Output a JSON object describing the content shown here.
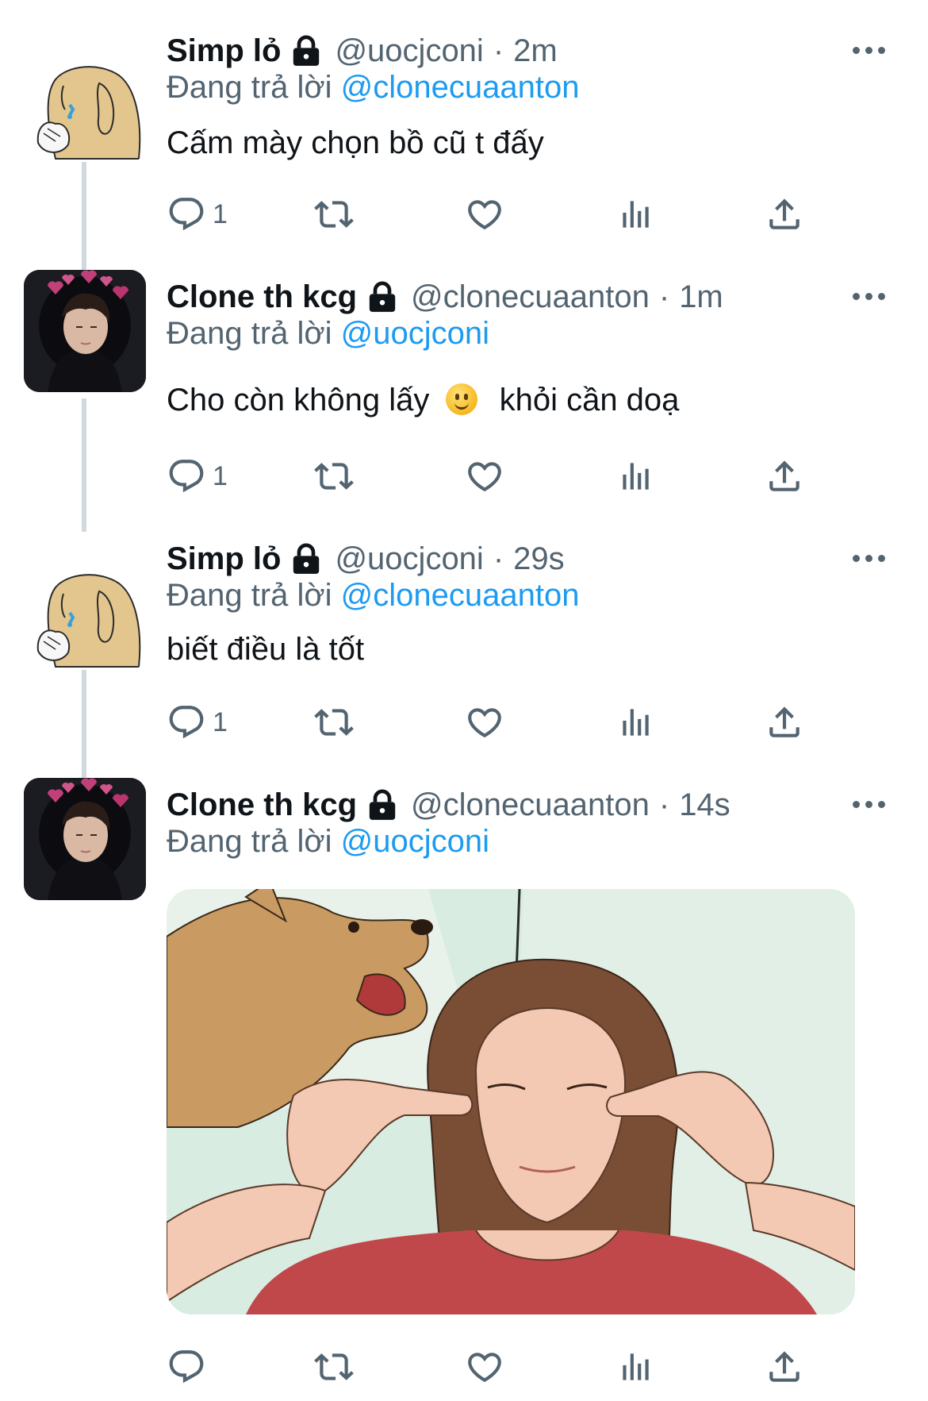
{
  "replying_label": "Đang trả lời",
  "tweets": [
    {
      "name": "Simp lỏ",
      "handle": "@uocjconi",
      "separator": "·",
      "time": "2m",
      "reply_to": "@clonecuaanton",
      "text": "Cấm mày chọn bồ cũ t đấy",
      "reply_count": "1",
      "avatar": "crying-dog-avatar"
    },
    {
      "name": "Clone th kcg",
      "handle": "@clonecuaanton",
      "separator": "·",
      "time": "1m",
      "reply_to": "@uocjconi",
      "text_before_emoji": "Cho còn không lấy",
      "emoji": "slightly-smiling-face",
      "text_after_emoji": "khỏi cần doạ",
      "reply_count": "1",
      "avatar": "person-with-hearts-avatar"
    },
    {
      "name": "Simp lỏ",
      "handle": "@uocjconi",
      "separator": "·",
      "time": "29s",
      "reply_to": "@clonecuaanton",
      "text": "biết điều là tốt",
      "reply_count": "1",
      "avatar": "crying-dog-avatar"
    },
    {
      "name": "Clone th kcg",
      "handle": "@clonecuaanton",
      "separator": "·",
      "time": "14s",
      "reply_to": "@uocjconi",
      "media": "illustration-barking-dog-woman-covering-ears",
      "reply_count": "",
      "avatar": "person-with-hearts-avatar"
    }
  ],
  "icons": [
    "reply-icon",
    "retweet-icon",
    "like-icon",
    "analytics-icon",
    "share-icon",
    "lock-icon",
    "more-icon"
  ],
  "colors": {
    "link": "#1d9bf0",
    "secondary": "#536471",
    "text": "#0f1419",
    "thread_line": "#cfd9de"
  }
}
